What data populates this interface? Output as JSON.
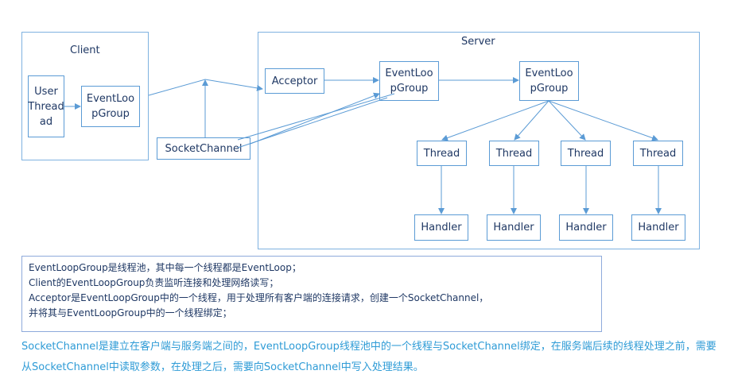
{
  "client": {
    "title": "Client",
    "user_thread": "User\nThread\nad",
    "event_loop_group": "EventLoo\npGroup"
  },
  "socket_channel": "SocketChannel",
  "server": {
    "title": "Server",
    "acceptor": "Acceptor",
    "boss_group": "EventLoo\npGroup",
    "worker_group": "EventLoo\npGroup",
    "threads": [
      "Thread",
      "Thread",
      "Thread",
      "Thread"
    ],
    "handlers": [
      "Handler",
      "Handler",
      "Handler",
      "Handler"
    ]
  },
  "notes": [
    "EventLoopGroup是线程池，其中每一个线程都是EventLoop；",
    "Client的EventLoopGroup负责监听连接和处理网络读写；",
    "Acceptor是EventLoopGroup中的一个线程，用于处理所有客户端的连接请求，创建一个SocketChannel，",
    "并将其与EventLoopGroup中的一个线程绑定；"
  ],
  "caption": "SocketChannel是建立在客户端与服务端之间的，EventLoopGroup线程池中的一个线程与SocketChannel绑定，在服务端后续的线程处理之前，需要从SocketChannel中读取参数，在处理之后，需要向SocketChannel中写入处理结果。",
  "colors": {
    "box_border": "#5b9bd5",
    "text": "#1f3864",
    "caption": "#2e9bd6"
  }
}
